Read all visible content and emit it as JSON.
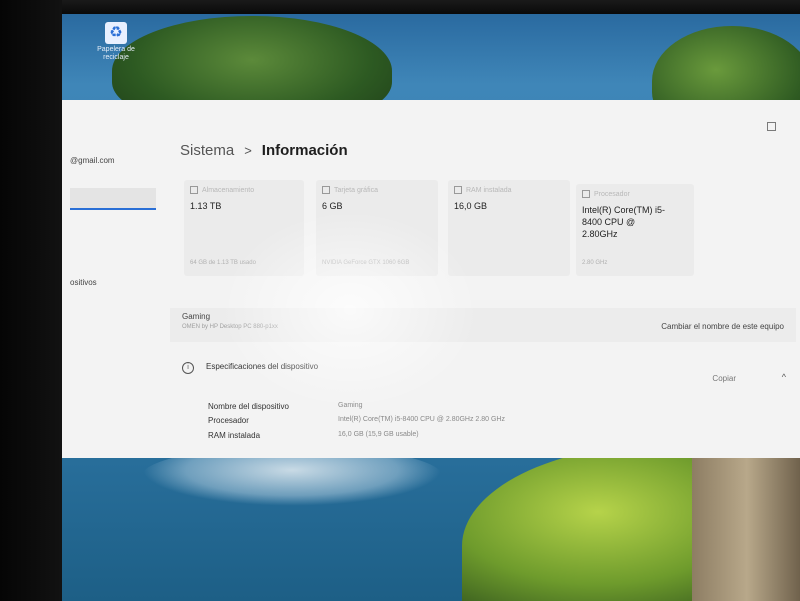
{
  "desktop": {
    "icon_label": "Papelera de reciclaje"
  },
  "sidebar": {
    "account_email": "@gmail.com",
    "items": [
      {
        "label": "ositivos"
      }
    ]
  },
  "breadcrumb": {
    "parent": "Sistema",
    "separator": ">",
    "current": "Información"
  },
  "cards": [
    {
      "label": "Almacenamiento",
      "value": "1.13 TB",
      "sub": "64 GB de 1.13 TB usado",
      "icon": "storage-icon"
    },
    {
      "label": "Tarjeta gráfica",
      "value": "6 GB",
      "sub": "NVIDIA GeForce GTX 1060 6GB",
      "icon": "gpu-icon"
    },
    {
      "label": "RAM instalada",
      "value": "16,0 GB",
      "sub": "",
      "icon": "ram-icon"
    },
    {
      "label": "Procesador",
      "value": "Intel(R) Core(TM) i5-8400 CPU @ 2.80GHz",
      "sub": "2.80 GHz",
      "icon": "processor-icon"
    }
  ],
  "device": {
    "name": "Gaming",
    "model": "OMEN by HP Desktop PC 880-p1xx",
    "rename_label": "Cambiar el nombre de este equipo"
  },
  "specs": {
    "title": "Especificaciones del dispositivo",
    "copy_label": "Copiar",
    "rows": [
      {
        "key": "Nombre del dispositivo",
        "value": "Gaming"
      },
      {
        "key": "Procesador",
        "value": "Intel(R) Core(TM) i5-8400 CPU @ 2.80GHz   2.80 GHz"
      },
      {
        "key": "RAM instalada",
        "value": "16,0 GB (15,9 GB usable)"
      }
    ]
  }
}
